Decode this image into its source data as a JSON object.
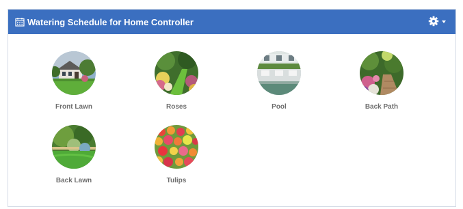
{
  "panel": {
    "title": "Watering Schedule for Home Controller",
    "icon": "calendar-icon",
    "settings_icon": "gear-icon"
  },
  "zones": [
    {
      "name": "Front Lawn",
      "image": "house-with-lawn"
    },
    {
      "name": "Roses",
      "image": "rose-garden-path"
    },
    {
      "name": "Pool",
      "image": "pool-with-chairs"
    },
    {
      "name": "Back Path",
      "image": "flower-lined-path"
    },
    {
      "name": "Back Lawn",
      "image": "lawn-with-trees"
    },
    {
      "name": "Tulips",
      "image": "tulip-bed"
    }
  ],
  "colors": {
    "header_bg": "#3b6fc0",
    "label": "#6d6d6d"
  }
}
